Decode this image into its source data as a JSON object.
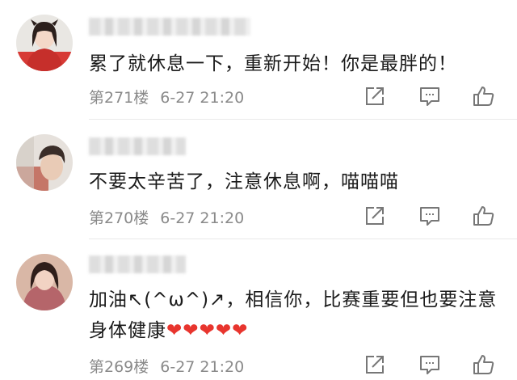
{
  "comments": [
    {
      "text": "累了就休息一下，重新开始！你是最胖的！",
      "floor": "第271楼",
      "time": "6-27 21:20"
    },
    {
      "text": "不要太辛苦了，注意休息啊，喵喵喵",
      "floor": "第270楼",
      "time": "6-27 21:20"
    },
    {
      "text": "加油↖(^ω^)↗，相信你，比赛重要但也要注意身体健康❤❤❤❤❤",
      "floor": "第269楼",
      "time": "6-27 21:20"
    }
  ],
  "colors": {
    "text": "#1a1a1a",
    "meta": "#8a8a8a",
    "icon": "#777777",
    "heart": "#e8352e"
  },
  "icons": [
    "share-icon",
    "reply-icon",
    "like-icon"
  ]
}
